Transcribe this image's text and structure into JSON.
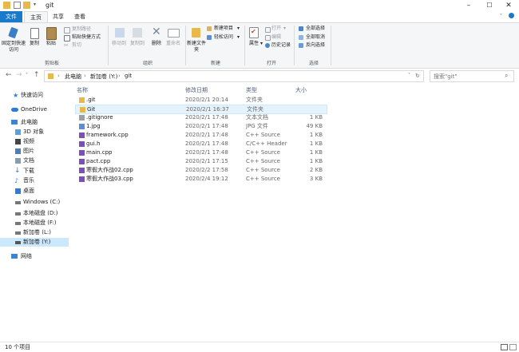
{
  "window": {
    "title": "git",
    "minimize": "–",
    "maximize": "☐",
    "close": "✕"
  },
  "ribbon_tabs": [
    "文件",
    "主页",
    "共享",
    "查看"
  ],
  "ribbon": {
    "clipboard": {
      "pin_quick_access": "固定到快速访问",
      "copy": "复制",
      "paste": "粘贴",
      "copy_path": "复制路径",
      "paste_shortcut": "粘贴快捷方式",
      "cut": "剪切",
      "group": "剪贴板"
    },
    "organize": {
      "move_to": "移动到",
      "copy_to": "复制到",
      "delete": "删除",
      "rename": "重命名",
      "group": "组织"
    },
    "new": {
      "new_folder": "新建文件夹",
      "new_item": "新建项目",
      "easy_access": "轻松访问",
      "group": "新建"
    },
    "open": {
      "properties": "属性",
      "open": "打开",
      "edit": "编辑",
      "history": "历史记录",
      "group": "打开"
    },
    "select": {
      "select_all": "全部选择",
      "select_none": "全部取消",
      "invert": "反向选择",
      "group": "选择"
    }
  },
  "address": {
    "crumbs": [
      "此电脑",
      "新加卷 (Y:)",
      "git"
    ],
    "sep": "›",
    "search_placeholder": "搜索\"git\""
  },
  "sidebar": [
    {
      "label": "快速访问",
      "icon": "star-icon"
    },
    {
      "label": "OneDrive",
      "icon": "cloud-icon"
    },
    {
      "label": "此电脑",
      "icon": "computer-icon"
    },
    {
      "label": "3D 对象",
      "icon": "cube-icon"
    },
    {
      "label": "视频",
      "icon": "video-icon"
    },
    {
      "label": "图片",
      "icon": "picture-icon"
    },
    {
      "label": "文档",
      "icon": "document-icon"
    },
    {
      "label": "下载",
      "icon": "download-icon"
    },
    {
      "label": "音乐",
      "icon": "music-icon"
    },
    {
      "label": "桌面",
      "icon": "desktop-icon"
    },
    {
      "label": "Windows (C:)",
      "icon": "drive-icon"
    },
    {
      "label": "本地磁盘 (D:)",
      "icon": "drive-icon"
    },
    {
      "label": "本地磁盘 (F:)",
      "icon": "drive-icon"
    },
    {
      "label": "新加卷 (L:)",
      "icon": "drive-icon"
    },
    {
      "label": "新加卷 (Y:)",
      "icon": "drive-icon",
      "selected": true
    },
    {
      "label": "网络",
      "icon": "network-icon"
    }
  ],
  "columns": [
    "名称",
    "修改日期",
    "类型",
    "大小"
  ],
  "files": [
    {
      "name": ".git",
      "date": "2020/2/1 20:14",
      "type": "文件夹",
      "size": "",
      "icon": "folder-icon"
    },
    {
      "name": "Git",
      "date": "2020/2/1 16:37",
      "type": "文件夹",
      "size": "",
      "icon": "folder-icon",
      "selected": true
    },
    {
      "name": ".gitignore",
      "date": "2020/2/1 17:48",
      "type": "文本文档",
      "size": "1 KB",
      "icon": "text-file-icon"
    },
    {
      "name": "1.jpg",
      "date": "2020/2/1 17:48",
      "type": "JPG 文件",
      "size": "49 KB",
      "icon": "image-file-icon"
    },
    {
      "name": "framework.cpp",
      "date": "2020/2/1 17:48",
      "type": "C++ Source",
      "size": "1 KB",
      "icon": "cpp-file-icon"
    },
    {
      "name": "gui.h",
      "date": "2020/2/1 17:48",
      "type": "C/C++ Header",
      "size": "1 KB",
      "icon": "header-file-icon"
    },
    {
      "name": "main.cpp",
      "date": "2020/2/1 17:48",
      "type": "C++ Source",
      "size": "1 KB",
      "icon": "cpp-file-icon"
    },
    {
      "name": "pact.cpp",
      "date": "2020/2/1 17:15",
      "type": "C++ Source",
      "size": "1 KB",
      "icon": "cpp-file-icon"
    },
    {
      "name": "寒假大作战02.cpp",
      "date": "2020/2/2 17:58",
      "type": "C++ Source",
      "size": "2 KB",
      "icon": "cpp-file-icon"
    },
    {
      "name": "寒假大作战03.cpp",
      "date": "2020/2/4 19:12",
      "type": "C++ Source",
      "size": "3 KB",
      "icon": "cpp-file-icon"
    }
  ],
  "status": {
    "count": "10 个项目"
  },
  "colors": {
    "accent": "#1979ca",
    "selection": "#cce8ff",
    "folder": "#e8b94a"
  }
}
